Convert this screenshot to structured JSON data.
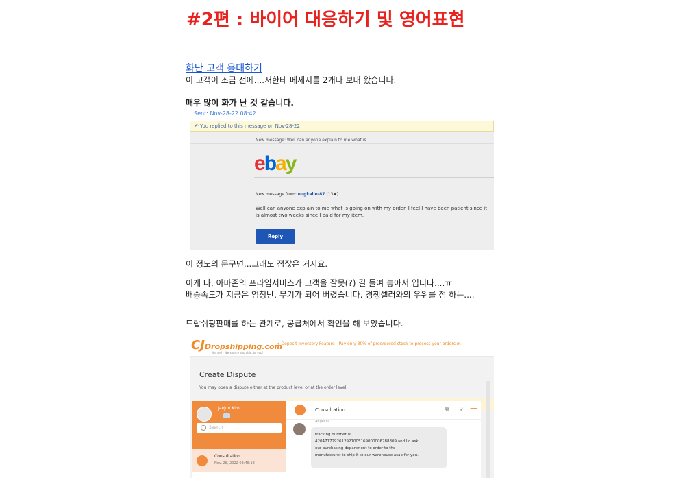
{
  "page": {
    "title": "#2편 : 바이어 대응하기 및 영어표현",
    "section_link": "화난 고객 응대하기",
    "intro": "이 고객이 조금 전에....저한테 메세지를 2개나 보내 왔습니다.",
    "emphasis": "매우 많이 화가 난 것 같습니다.",
    "para_after_ebay": "이 정도의 문구면...그래도 점잖은 거지요.",
    "para2_line1": "이게 다, 아마존의 프라임서비스가 고객을 잘못(?) 길 들여 놓아서 입니다....ㅠ",
    "para2_line2": "배송속도가 지금은 엄청난, 무기가 되어 버렸습니다. 경쟁셀러와의 우위를 점 하는....",
    "para3": "드랍쉬핑판매를 하는 관계로, 공급처에서 확인을 해 보았습니다."
  },
  "ebay": {
    "sent": "Sent: Nov-28-22 08:42",
    "replied": "You replied to this message on Nov-28-22",
    "new_message_bar": "New message: Well can anyone explain to me what is...",
    "logo": {
      "e": "e",
      "b": "b",
      "a": "a",
      "y": "y"
    },
    "from_label": "New message from:",
    "from_user": "eugkalle-87",
    "from_score": "(13★)",
    "message": "Well can anyone explain to me what is going on with my order. I feel I have been patient since it is almost two weeks since I paid for my item.",
    "reply_button": "Reply"
  },
  "cj": {
    "logo_cj": "CJ",
    "logo_text": "Dropshipping.com",
    "logo_tagline": "You sell · We source and ship for you!",
    "notice": "Deposit Inventory Feature - Pay only 30% of preordered stock to process your orders m",
    "dispute_title": "Create Dispute",
    "dispute_sub": "You may open a dispute either at the product level or at the order level.",
    "user_name": "Jaejun Kim",
    "search_placeholder": "Search",
    "conversation_label": "Consultation",
    "conversation_date": "Nov. 28, 2022 03:46:18",
    "chat_title": "Consultation",
    "agent_name": "Angel D",
    "bubble_lines": [
      "tracking number is",
      "420471729261292700516900000628880​9 and I'd ask",
      "our purchasing department to order to the",
      "manufacturer to ship it to our warehouse asap for you."
    ],
    "icons": {
      "window": "⧉",
      "pin": "⚲",
      "minus": "—"
    }
  }
}
